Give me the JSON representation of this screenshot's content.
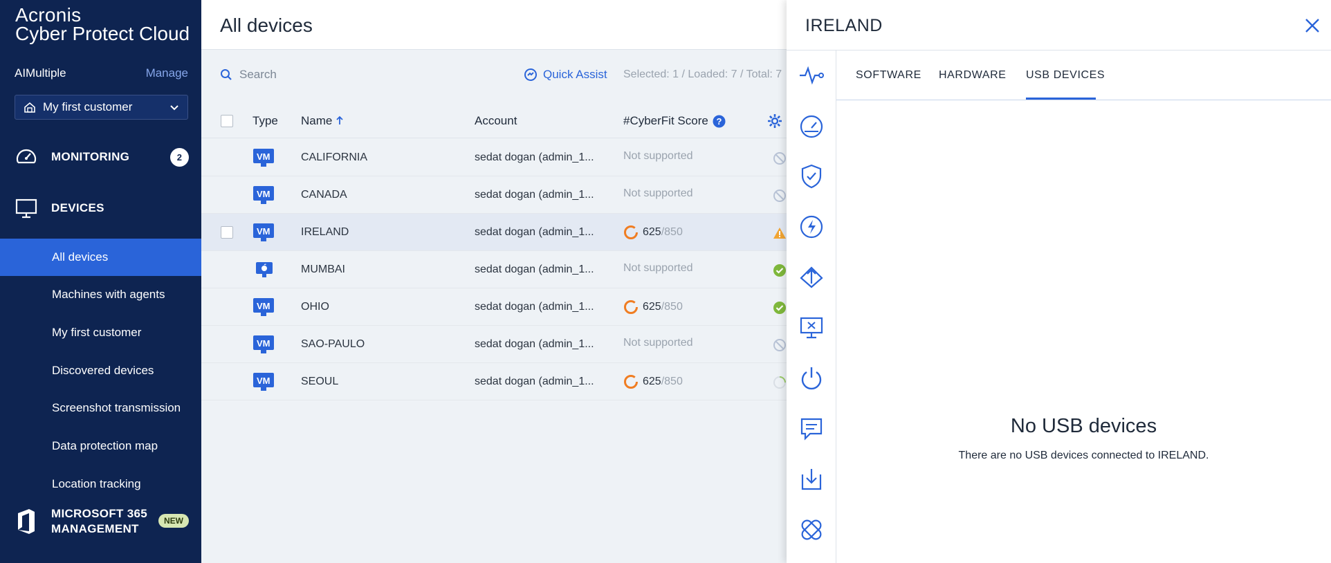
{
  "brand": {
    "line1": "Acronis",
    "line2": "Cyber Protect Cloud"
  },
  "customer": {
    "name": "AIMultiple",
    "manage_label": "Manage",
    "selected": "My first customer"
  },
  "nav": {
    "monitoring": {
      "label": "MONITORING",
      "badge": "2"
    },
    "devices": {
      "label": "DEVICES"
    },
    "sub_items": [
      {
        "label": "All devices",
        "active": true
      },
      {
        "label": "Machines with agents"
      },
      {
        "label": "My first customer"
      },
      {
        "label": "Discovered devices"
      },
      {
        "label": "Screenshot transmission"
      },
      {
        "label": "Data protection map"
      },
      {
        "label": "Location tracking"
      }
    ],
    "ms365": {
      "line1": "MICROSOFT 365",
      "line2": "MANAGEMENT",
      "badge": "NEW"
    }
  },
  "main": {
    "title": "All devices",
    "search_placeholder": "Search",
    "quick_assist": "Quick Assist",
    "selection_info": "Selected: 1 / Loaded: 7 / Total: 7"
  },
  "table": {
    "columns": {
      "type": "Type",
      "name": "Name",
      "account": "Account",
      "score": "#CyberFit Score"
    },
    "rows": [
      {
        "type_label": "VM",
        "type_icon": "vm-icon",
        "name": "CALIFORNIA",
        "account": "sedat dogan (admin_1...",
        "score": "Not supported",
        "status": "unsupported"
      },
      {
        "type_label": "VM",
        "type_icon": "vm-icon",
        "name": "CANADA",
        "account": "sedat dogan (admin_1...",
        "score": "Not supported",
        "status": "unsupported"
      },
      {
        "type_label": "VM",
        "type_icon": "vm-icon",
        "name": "IRELAND",
        "account": "sedat dogan (admin_1...",
        "score": "625",
        "score_max": "/850",
        "status": "warning"
      },
      {
        "type_label": "",
        "type_icon": "mac-icon",
        "name": "MUMBAI",
        "account": "sedat dogan (admin_1...",
        "score": "Not supported",
        "status": "ok"
      },
      {
        "type_label": "VM",
        "type_icon": "vm-icon",
        "name": "OHIO",
        "account": "sedat dogan (admin_1...",
        "score": "625",
        "score_max": "/850",
        "status": "ok"
      },
      {
        "type_label": "VM",
        "type_icon": "vm-icon",
        "name": "SAO-PAULO",
        "account": "sedat dogan (admin_1...",
        "score": "Not supported",
        "status": "unsupported"
      },
      {
        "type_label": "VM",
        "type_icon": "vm-icon",
        "name": "SEOUL",
        "account": "sedat dogan (admin_1...",
        "score": "625",
        "score_max": "/850",
        "status": "loading"
      }
    ]
  },
  "panel": {
    "title": "IRELAND",
    "tabs": [
      "SOFTWARE",
      "HARDWARE",
      "USB DEVICES"
    ],
    "active_tab": "USB DEVICES",
    "empty_title": "No USB devices",
    "empty_message": "There are no USB devices connected to IRELAND.",
    "side_icons": [
      "activity-icon",
      "dashboard-icon",
      "shield-check-icon",
      "lightning-icon",
      "recovery-icon",
      "remote-desktop-icon",
      "power-icon",
      "chat-icon",
      "download-icon",
      "patch-icon"
    ]
  },
  "colors": {
    "sidebar": "#0e2451",
    "accent": "#2a64d9",
    "score_ring": "#f07d22",
    "ok": "#7fb83c",
    "warning": "#f2a533"
  }
}
